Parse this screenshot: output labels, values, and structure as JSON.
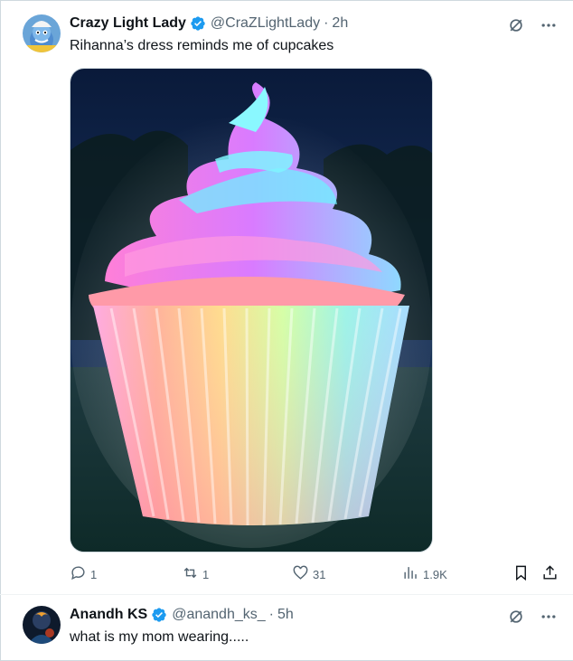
{
  "tweets": [
    {
      "name": "Crazy Light Lady",
      "handle": "@CraZLightLady",
      "separator": "·",
      "time": "2h",
      "text": "Rihanna’s dress reminds me of cupcakes",
      "verified": true,
      "media": "glowing rainbow cupcake with blue-pink frosting",
      "stats": {
        "replies": "1",
        "reposts": "1",
        "likes": "31",
        "views": "1.9K"
      }
    },
    {
      "name": "Anandh KS",
      "handle": "@anandh_ks_",
      "separator": "·",
      "time": "5h",
      "text": "what is my mom wearing.....",
      "verified": true
    }
  ],
  "icons": {
    "verified": "verified-badge-icon",
    "grok": "grok-icon",
    "more": "more-icon",
    "reply": "reply-icon",
    "repost": "repost-icon",
    "like": "like-icon",
    "views": "views-icon",
    "bookmark": "bookmark-icon",
    "share": "share-icon"
  },
  "colors": {
    "accent": "#1d9bf0",
    "text": "#0f1419",
    "secondary": "#536471"
  }
}
